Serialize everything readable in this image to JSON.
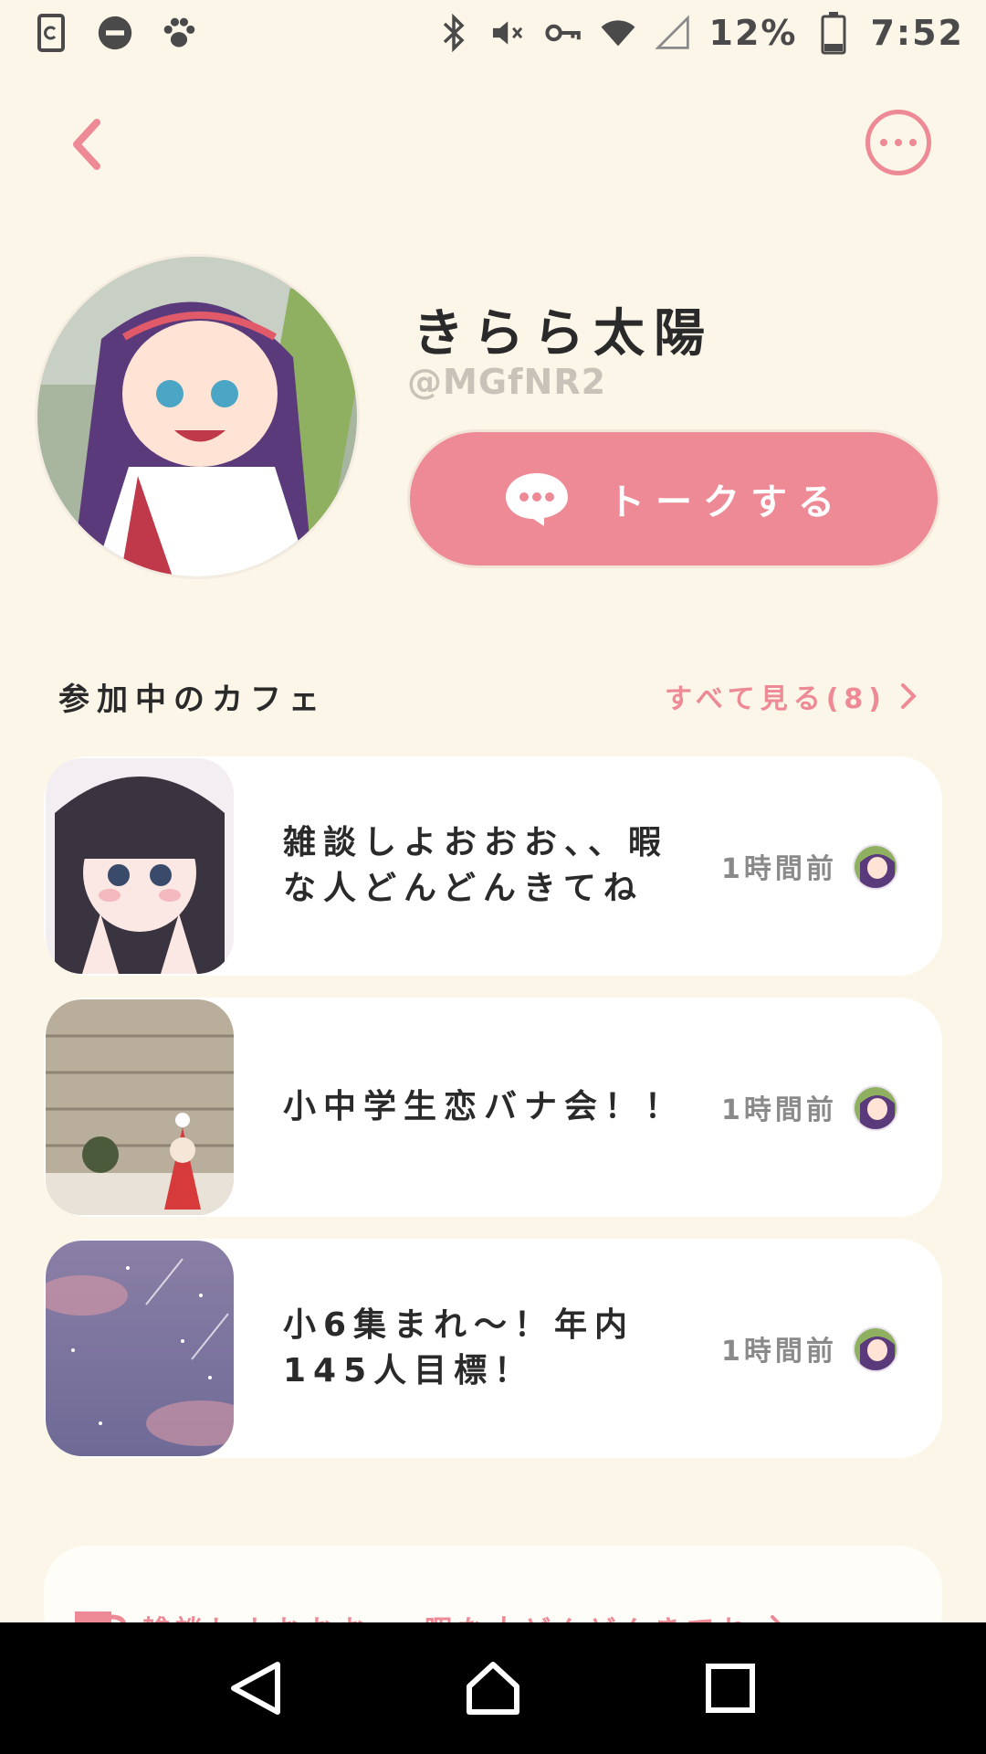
{
  "status_bar": {
    "battery": "12%",
    "time": "7:52",
    "icons_left": [
      "phone-sync-icon",
      "do-not-disturb-icon",
      "paw-icon"
    ],
    "icons_right": [
      "bluetooth-icon",
      "mute-icon",
      "vpn-key-icon",
      "wifi-icon",
      "signal-icon",
      "battery-icon"
    ]
  },
  "header": {
    "back_icon": "chevron-left-icon",
    "more_icon": "more-horizontal-icon"
  },
  "profile": {
    "name": "きらら太陽",
    "handle": "@MGfNR2",
    "talk_button": "トークする"
  },
  "cafes": {
    "section_title": "参加中のカフェ",
    "see_all": "すべて見る(8)",
    "items": [
      {
        "title": "雑談しよおおお、、暇な人どんどんきてね",
        "time": "1時間前"
      },
      {
        "title": "小中学生恋バナ会！！",
        "time": "1時間前"
      },
      {
        "title": "小6集まれ〜！年内145人目標！",
        "time": "1時間前"
      }
    ]
  },
  "banner": {
    "text": "雑談しよおおお、、暇な人どんどんきてね"
  },
  "colors": {
    "background": "#fcf6e9",
    "accent": "#ee8a96",
    "card": "#ffffff"
  }
}
